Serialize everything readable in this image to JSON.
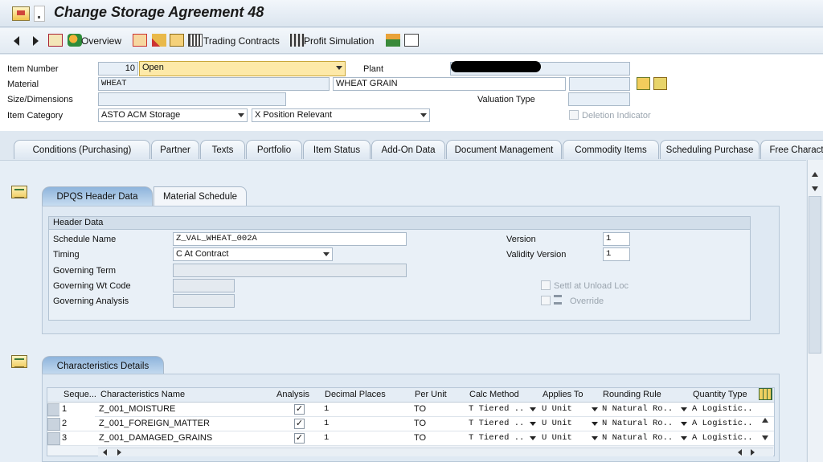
{
  "window": {
    "title": "Change Storage Agreement 48"
  },
  "toolbar": {
    "overview": "Overview",
    "trading_contracts": "Trading Contracts",
    "profit_simulation": "Profit Simulation"
  },
  "item": {
    "item_number_label": "Item Number",
    "item_number": "10",
    "status": "Open",
    "plant_label": "Plant",
    "material_label": "Material",
    "material": "WHEAT",
    "material_desc": "WHEAT GRAIN",
    "size_label": "Size/Dimensions",
    "valuation_type_label": "Valuation Type",
    "item_category_label": "Item Category",
    "item_category": "ASTO ACM Storage",
    "position": "X Position Relevant",
    "deletion_indicator": "Deletion Indicator"
  },
  "tabs": [
    "Conditions (Purchasing)",
    "Partner",
    "Texts",
    "Portfolio",
    "Item Status",
    "Add-On Data",
    "Document Management",
    "Commodity Items",
    "Scheduling Purchase",
    "Free Charact"
  ],
  "dpqs": {
    "subtabs": [
      "DPQS Header Data",
      "Material Schedule"
    ],
    "header_title": "Header Data",
    "schedule_name_label": "Schedule Name",
    "schedule_name": "Z_VAL_WHEAT_002A",
    "timing_label": "Timing",
    "timing": "C At Contract",
    "governing_term_label": "Governing Term",
    "governing_wt_label": "Governing Wt Code",
    "governing_analysis_label": "Governing Analysis",
    "version_label": "Version",
    "version": "1",
    "validity_version_label": "Validity Version",
    "validity_version": "1",
    "settl_label": "Settl at Unload Loc",
    "override_label": "Override"
  },
  "characteristics": {
    "tab": "Characteristics Details",
    "columns": [
      "Seque...",
      "Characteristics Name",
      "Analysis",
      "Decimal Places",
      "Per Unit",
      "Calc Method",
      "Applies To",
      "Rounding Rule",
      "Quantity Type"
    ],
    "rows": [
      {
        "seq": "1",
        "name": "Z_001_MOISTURE",
        "analysis": "✓",
        "decimals": "1",
        "per_unit": "TO",
        "calc": "T Tiered ..",
        "applies": "U Unit",
        "rounding": "N Natural Ro..",
        "qty": "A Logistic.."
      },
      {
        "seq": "2",
        "name": "Z_001_FOREIGN_MATTER",
        "analysis": "✓",
        "decimals": "1",
        "per_unit": "TO",
        "calc": "T Tiered ..",
        "applies": "U Unit",
        "rounding": "N Natural Ro..",
        "qty": "A Logistic.."
      },
      {
        "seq": "3",
        "name": "Z_001_DAMAGED_GRAINS",
        "analysis": "✓",
        "decimals": "1",
        "per_unit": "TO",
        "calc": "T Tiered ..",
        "applies": "U Unit",
        "rounding": "N Natural Ro..",
        "qty": "A Logistic.."
      }
    ]
  }
}
